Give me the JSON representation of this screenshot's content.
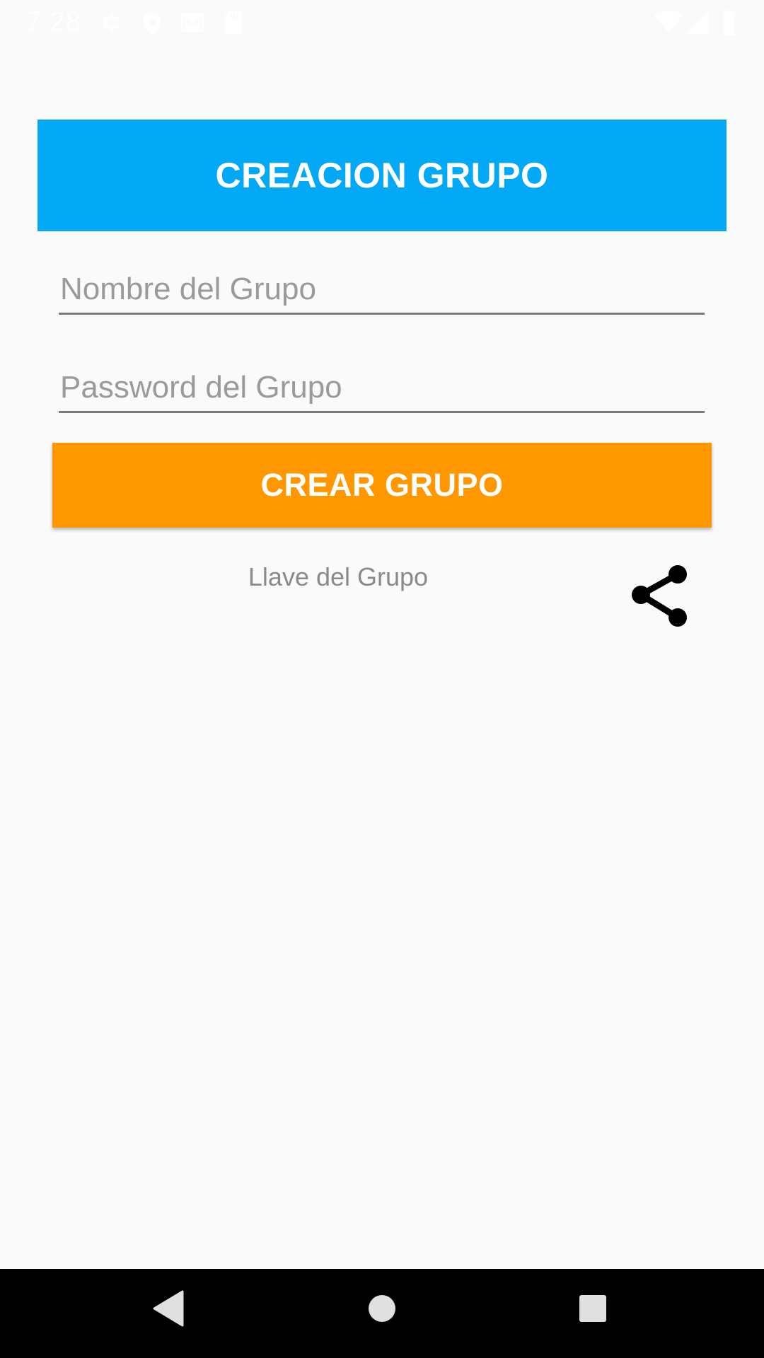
{
  "status_bar": {
    "time": "7:28",
    "icons": [
      "gear-icon",
      "shield-icon",
      "gmail-icon",
      "sd-card-icon",
      "wifi-icon",
      "signal-icon",
      "battery-icon"
    ]
  },
  "header": {
    "title": "CREACION GRUPO",
    "background_color": "#03a9f4"
  },
  "form": {
    "group_name": {
      "value": "",
      "placeholder": "Nombre del Grupo"
    },
    "group_password": {
      "value": "",
      "placeholder": "Password del Grupo"
    },
    "create_button_label": "CREAR GRUPO",
    "button_color": "#ff9800"
  },
  "key_section": {
    "label": "Llave del Grupo",
    "share_icon": "share-icon"
  },
  "nav_bar": {
    "buttons": [
      "back-icon",
      "home-icon",
      "recents-icon"
    ]
  }
}
